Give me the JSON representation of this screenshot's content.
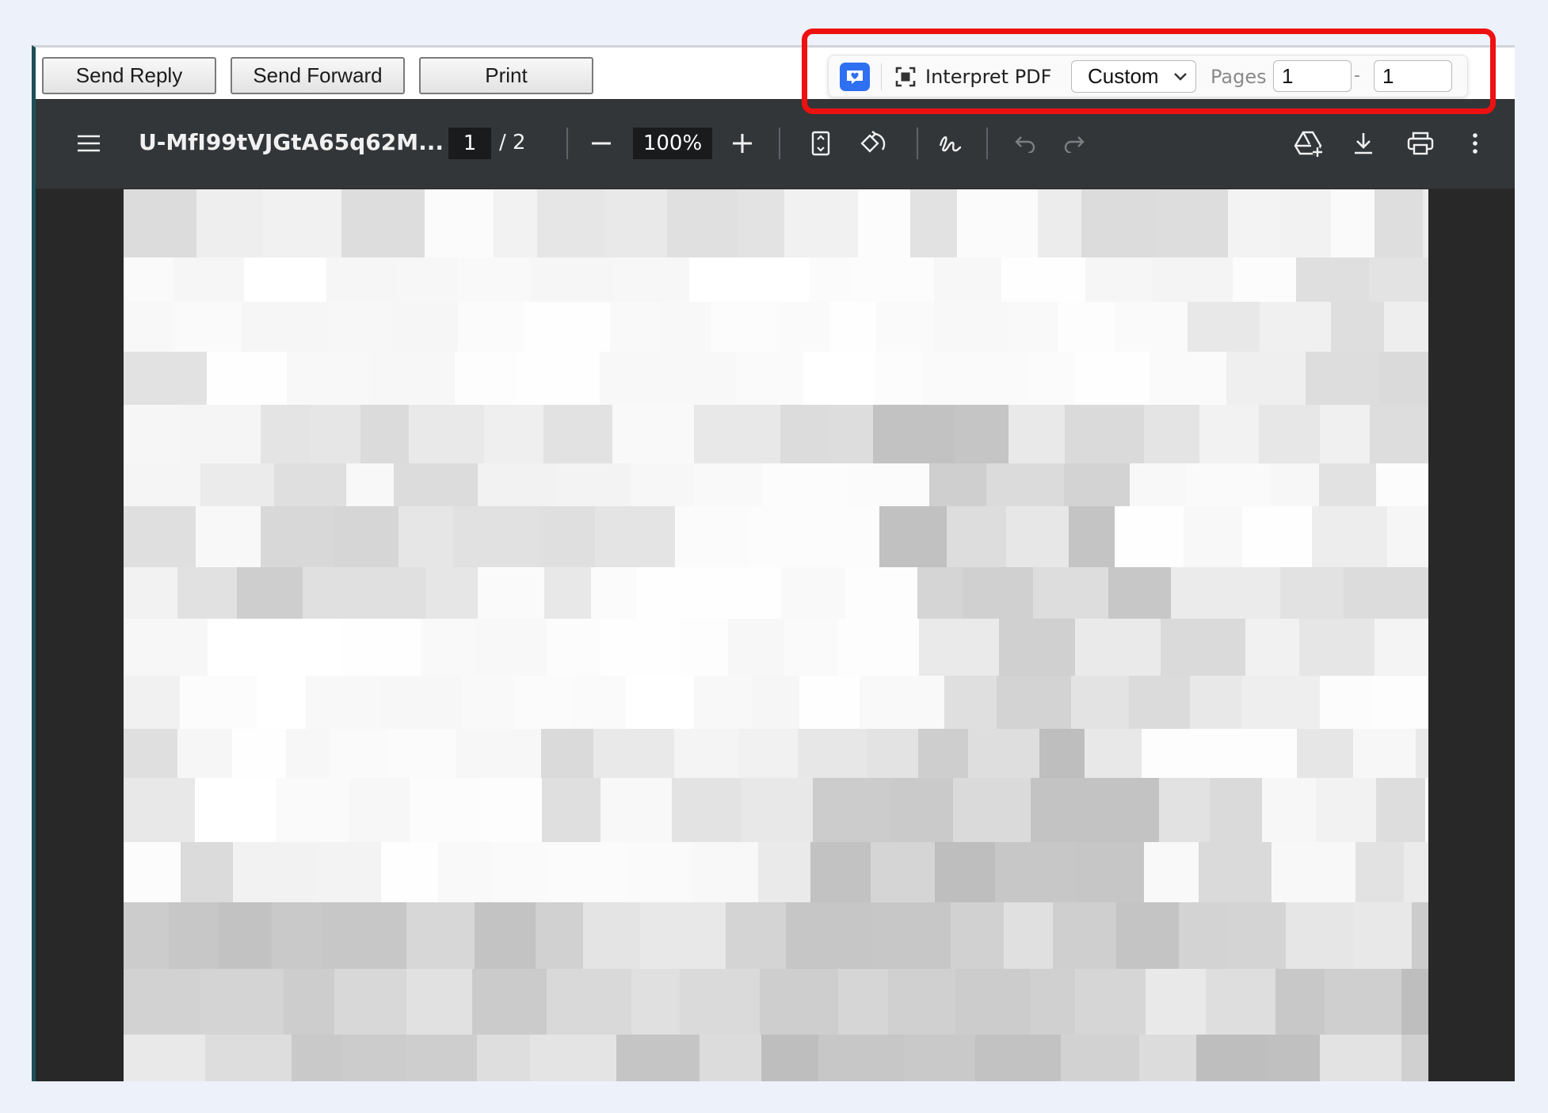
{
  "mail_toolbar": {
    "send_reply": "Send Reply",
    "send_forward": "Send Forward",
    "print": "Print"
  },
  "extension": {
    "logo_icon": "heart-chat-icon",
    "interpret_label": "Interpret PDF",
    "mode_select": "Custom",
    "pages_label": "Pages",
    "page_from": "1",
    "page_dash": "-",
    "page_to": "1",
    "accent": "#2f6ff2",
    "highlight_color": "#ee1111"
  },
  "pdf_toolbar": {
    "filename": "U-MfI99tVJGtA65q62M...",
    "current_page": "1",
    "page_total": "/ 2",
    "zoom": "100%"
  },
  "colors": {
    "toolbar_bg": "#333639",
    "viewer_bg": "#282828",
    "page_bg": "#ffffff",
    "page_background": "#edf1fa"
  }
}
